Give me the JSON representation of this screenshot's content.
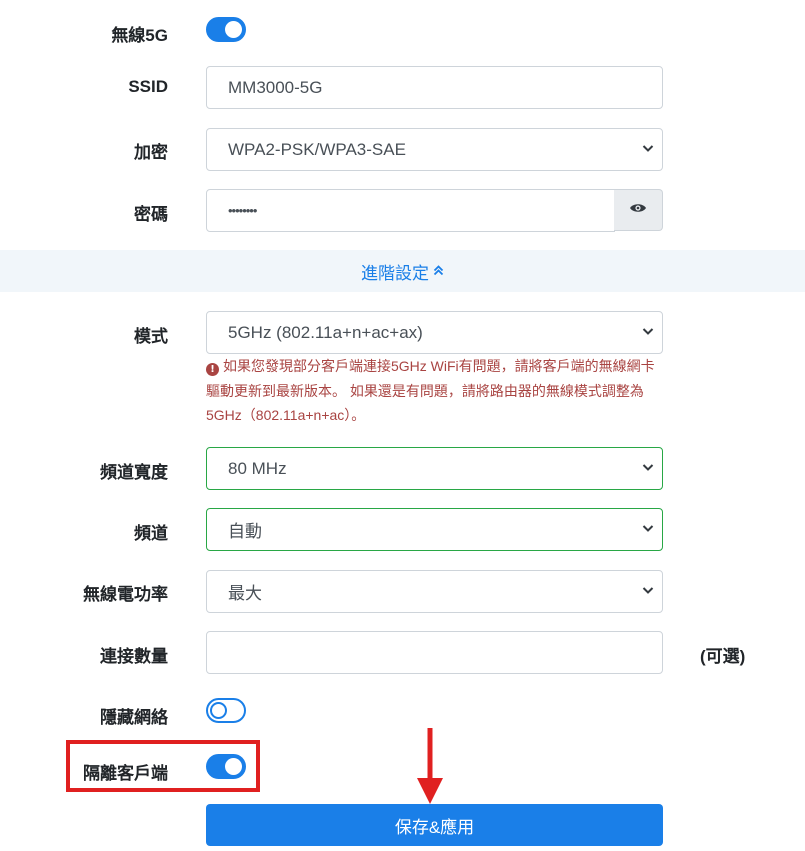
{
  "wireless5g": {
    "label": "無線5G",
    "enabled": true
  },
  "ssid": {
    "label": "SSID",
    "value": "MM3000-5G"
  },
  "encryption": {
    "label": "加密",
    "value": "WPA2-PSK/WPA3-SAE"
  },
  "password": {
    "label": "密碼",
    "value": "••••••••",
    "icon": "eye-icon"
  },
  "advanced": {
    "link_label": "進階設定",
    "icon": "chevron-double-up-icon"
  },
  "mode": {
    "label": "模式",
    "value": "5GHz (802.11a+n+ac+ax)",
    "warning": "如果您發現部分客戶端連接5GHz WiFi有問題，請將客戶端的無線網卡驅動更新到最新版本。 如果還是有問題，請將路由器的無線模式調整為5GHz（802.11a+n+ac）。"
  },
  "bandwidth": {
    "label": "頻道寬度",
    "value": "80 MHz"
  },
  "channel": {
    "label": "頻道",
    "value": "自動"
  },
  "power": {
    "label": "無線電功率",
    "value": "最大"
  },
  "max_clients": {
    "label": "連接數量",
    "value": "",
    "optional_label": "(可選)"
  },
  "hide_network": {
    "label": "隱藏網絡",
    "enabled": false
  },
  "client_isolation": {
    "label": "隔離客戶端",
    "enabled": true
  },
  "save_button": {
    "label": "保存&應用"
  },
  "colors": {
    "accent": "#1a7fe8",
    "valid": "#28a745",
    "warning": "#a94442",
    "highlight": "#e02020",
    "advanced_bg": "#f1f6fa"
  }
}
